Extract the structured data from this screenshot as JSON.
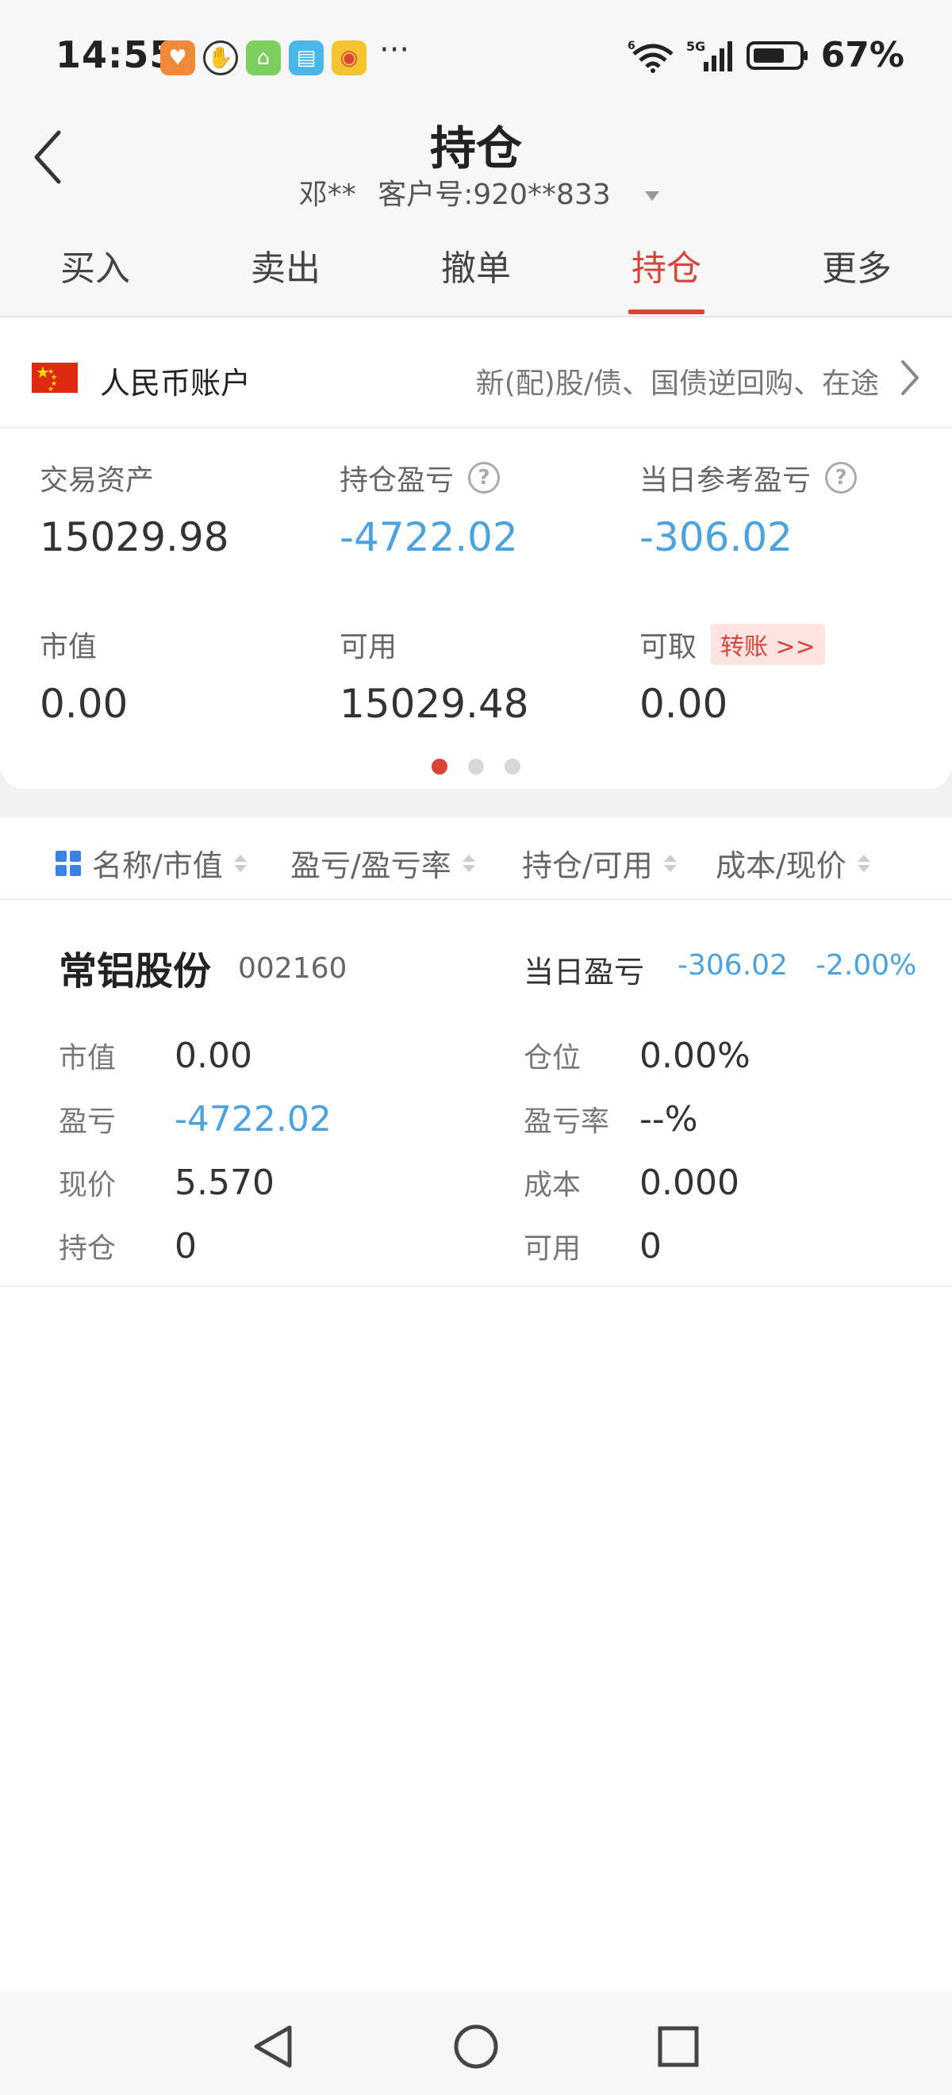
{
  "status_bar": {
    "time": "14:55",
    "more_glyph": "···",
    "battery": "67%",
    "net_label": "5G",
    "wifi_label": "6",
    "apps": [
      {
        "icon": "health-app-icon",
        "color": "#f08a3a"
      },
      {
        "icon": "hand-app-icon",
        "color": "#ffffff"
      },
      {
        "icon": "farm-app-icon",
        "color": "#7ccf5c"
      },
      {
        "icon": "book-app-icon",
        "color": "#4bb6e8"
      },
      {
        "icon": "weibo-app-icon",
        "color": "#f5c431"
      }
    ]
  },
  "header": {
    "title": "持仓",
    "user": "邓**",
    "customer_label": "客户号:920**833"
  },
  "tabs": [
    {
      "label": "买入",
      "active": false
    },
    {
      "label": "卖出",
      "active": false
    },
    {
      "label": "撤单",
      "active": false
    },
    {
      "label": "持仓",
      "active": true
    },
    {
      "label": "更多",
      "active": false
    }
  ],
  "account": {
    "name": "人民币账户",
    "description": "新(配)股/债、国债逆回购、在途",
    "metrics": {
      "trade_assets": {
        "label": "交易资产",
        "value": "15029.98"
      },
      "position_pnl": {
        "label": "持仓盈亏",
        "value": "-4722.02"
      },
      "daily_ref_pnl": {
        "label": "当日参考盈亏",
        "value": "-306.02"
      },
      "market_value": {
        "label": "市值",
        "value": "0.00"
      },
      "available": {
        "label": "可用",
        "value": "15029.48"
      },
      "withdrawable": {
        "label": "可取",
        "value": "0.00"
      }
    },
    "transfer_label": "转账 >>",
    "page_index": 1,
    "page_count": 3
  },
  "sort_columns": [
    {
      "label": "名称/市值"
    },
    {
      "label": "盈亏/盈亏率"
    },
    {
      "label": "持仓/可用"
    },
    {
      "label": "成本/现价"
    }
  ],
  "holding": {
    "name": "常铝股份",
    "code": "002160",
    "daily_label": "当日盈亏",
    "daily_value": "-306.02",
    "daily_pct": "-2.00%",
    "left": [
      {
        "k": "市值",
        "v": "0.00"
      },
      {
        "k": "盈亏",
        "v": "-4722.02"
      },
      {
        "k": "现价",
        "v": "5.570"
      },
      {
        "k": "持仓",
        "v": "0"
      }
    ],
    "right": [
      {
        "k": "仓位",
        "v": "0.00%"
      },
      {
        "k": "盈亏率",
        "v": "--%"
      },
      {
        "k": "成本",
        "v": "0.000"
      },
      {
        "k": "可用",
        "v": "0"
      }
    ]
  },
  "colors": {
    "accent_red": "#d9443a",
    "loss_blue": "#4aa3df",
    "grid_icon_blue": "#3b82e6"
  }
}
